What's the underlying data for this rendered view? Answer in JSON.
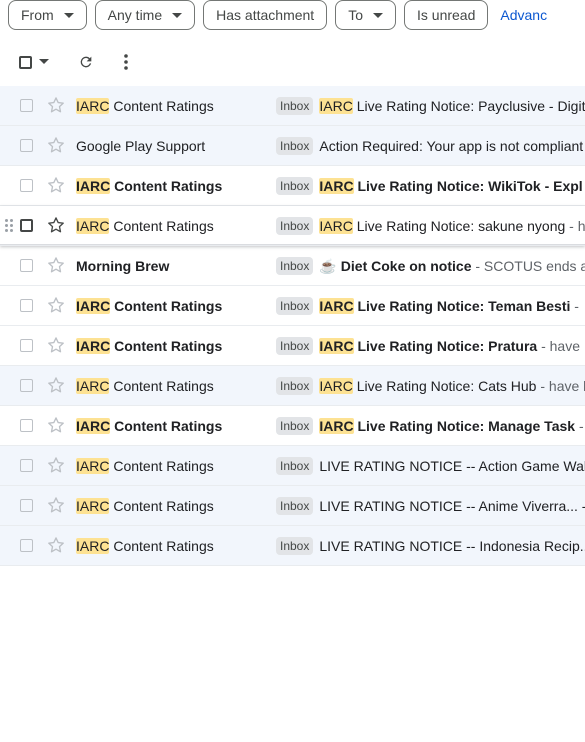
{
  "filters": {
    "chips": [
      {
        "label": "From",
        "dropdown": true
      },
      {
        "label": "Any time",
        "dropdown": true
      },
      {
        "label": "Has attachment",
        "dropdown": false
      },
      {
        "label": "To",
        "dropdown": true
      },
      {
        "label": "Is unread",
        "dropdown": false
      }
    ],
    "advanced_label": "Advanc"
  },
  "colors": {
    "highlight": "#fde293",
    "read_row": "#f2f6fc",
    "link": "#0b57d0"
  },
  "emails": [
    {
      "state": "read",
      "hover": false,
      "sender_hl": "IARC",
      "sender": "Content Ratings",
      "label": "Inbox",
      "subject_hl": "IARC",
      "subject": "Live Rating Notice: Payclusive - Digita",
      "snippet": ""
    },
    {
      "state": "read",
      "hover": false,
      "sender_hl": "",
      "sender": "Google Play Support",
      "label": "Inbox",
      "subject_hl": "",
      "subject": "Action Required: Your app is not compliant",
      "snippet": ""
    },
    {
      "state": "unread",
      "hover": false,
      "sender_hl": "IARC",
      "sender": "Content Ratings",
      "label": "Inbox",
      "subject_hl": "IARC",
      "subject": "Live Rating Notice: WikiTok - Expl",
      "snippet": ""
    },
    {
      "state": "read",
      "hover": true,
      "sender_hl": "IARC",
      "sender": "Content Ratings",
      "label": "Inbox",
      "subject_hl": "IARC",
      "subject": "Live Rating Notice: sakune nyong",
      "snippet": " - h"
    },
    {
      "state": "unread",
      "hover": false,
      "sender_hl": "",
      "sender": "Morning Brew",
      "label": "Inbox",
      "emoji": "☕",
      "subject_hl": "",
      "subject": "Diet Coke on notice",
      "snippet": " - SCOTUS ends a"
    },
    {
      "state": "unread",
      "hover": false,
      "sender_hl": "IARC",
      "sender": "Content Ratings",
      "label": "Inbox",
      "subject_hl": "IARC",
      "subject": "Live Rating Notice: Teman Besti",
      "snippet": " -"
    },
    {
      "state": "unread",
      "hover": false,
      "sender_hl": "IARC",
      "sender": "Content Ratings",
      "label": "Inbox",
      "subject_hl": "IARC",
      "subject": "Live Rating Notice: Pratura",
      "snippet": " - have"
    },
    {
      "state": "read",
      "hover": false,
      "sender_hl": "IARC",
      "sender": "Content Ratings",
      "label": "Inbox",
      "subject_hl": "IARC",
      "subject": "Live Rating Notice: Cats Hub",
      "snippet": " - have li"
    },
    {
      "state": "unread",
      "hover": false,
      "sender_hl": "IARC",
      "sender": "Content Ratings",
      "label": "Inbox",
      "subject_hl": "IARC",
      "subject": "Live Rating Notice: Manage Task",
      "snippet": " -"
    },
    {
      "state": "read",
      "hover": false,
      "sender_hl": "IARC",
      "sender": "Content Ratings",
      "label": "Inbox",
      "subject_hl": "",
      "subject": "LIVE RATING NOTICE -- Action Game Wal...",
      "snippet": ""
    },
    {
      "state": "read",
      "hover": false,
      "sender_hl": "IARC",
      "sender": "Content Ratings",
      "label": "Inbox",
      "subject_hl": "",
      "subject": "LIVE RATING NOTICE -- Anime Viverra... --",
      "snippet": ""
    },
    {
      "state": "read",
      "hover": false,
      "sender_hl": "IARC",
      "sender": "Content Ratings",
      "label": "Inbox",
      "subject_hl": "",
      "subject": "LIVE RATING NOTICE -- Indonesia Recip...",
      "snippet": ""
    }
  ]
}
